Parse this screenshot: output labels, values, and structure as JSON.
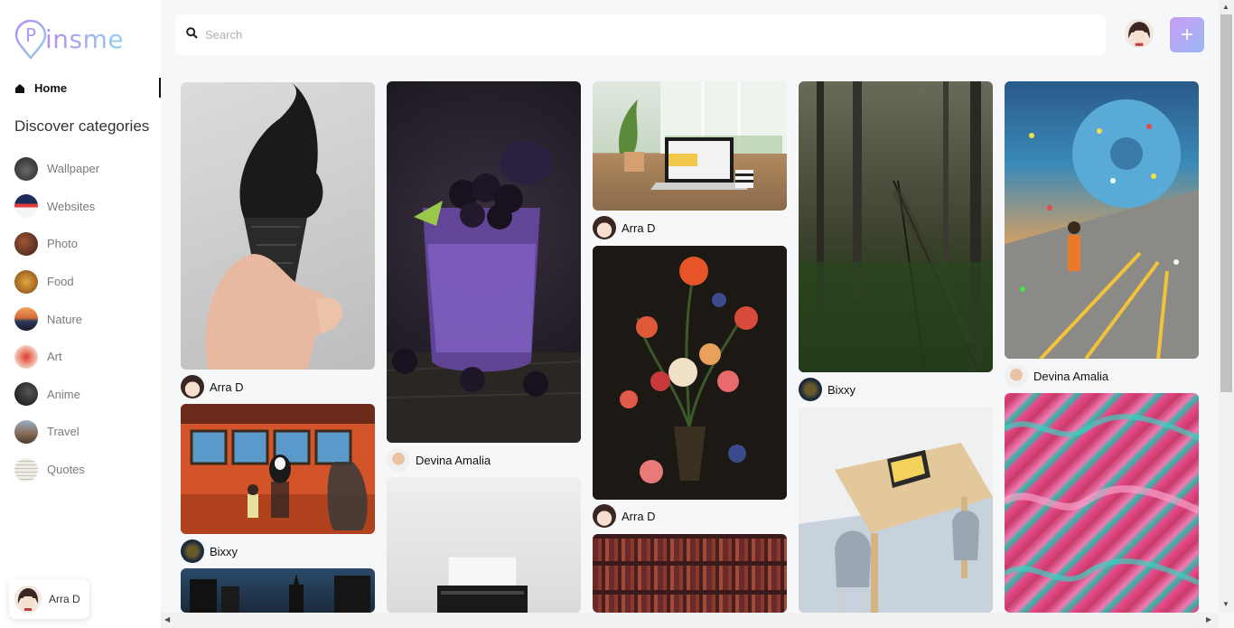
{
  "app": {
    "logo_letter": "P",
    "logo_text": "insme"
  },
  "nav": {
    "home_label": "Home"
  },
  "categories": {
    "title": "Discover categories",
    "items": [
      {
        "label": "Wallpaper",
        "color": "#3a3a3a"
      },
      {
        "label": "Websites",
        "color": "#2c3e7a"
      },
      {
        "label": "Photo",
        "color": "#6b3a2a"
      },
      {
        "label": "Food",
        "color": "#b36a1f"
      },
      {
        "label": "Nature",
        "color": "#c26b3a"
      },
      {
        "label": "Art",
        "color": "#d9755f"
      },
      {
        "label": "Anime",
        "color": "#2a2a2a"
      },
      {
        "label": "Travel",
        "color": "#8a6e5a"
      },
      {
        "label": "Quotes",
        "color": "#e4e0d6"
      }
    ]
  },
  "user": {
    "name": "Arra D"
  },
  "search": {
    "placeholder": "Search"
  },
  "add_button_label": "+",
  "pins": [
    {
      "author": "Arra D",
      "image": "ice-cream-cone"
    },
    {
      "author": "Bixxy",
      "image": "anime-train"
    },
    {
      "author": "Devina Amalia",
      "image": "blackberry-drink"
    },
    {
      "author": "Arra D",
      "image": "laptop-desk"
    },
    {
      "author": "Arra D",
      "image": "flower-still-life"
    },
    {
      "author": "Bixxy",
      "image": "forest-bridge"
    },
    {
      "author": "Devina Amalia",
      "image": "donut-street"
    }
  ],
  "colors": {
    "accent_start": "#c99cf6",
    "accent_end": "#9ab8f5"
  }
}
